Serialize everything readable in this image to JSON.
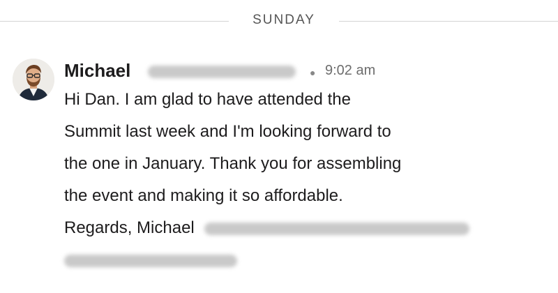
{
  "divider": {
    "day": "SUNDAY"
  },
  "message": {
    "sender_first_name": "Michael",
    "timestamp": "9:02 am",
    "lines": [
      "Hi Dan.  I am glad to have attended the",
      "Summit last week and I'm looking forward to",
      "the one in January.  Thank you for assembling",
      "the event and making it so affordable.",
      "Regards, Michael"
    ]
  },
  "colors": {
    "text": "#1d1c1d",
    "muted": "#6d6d6d",
    "divider": "#d4d4d4",
    "redaction": "#c9c9c9"
  },
  "icons": {
    "avatar": "user-avatar-photo"
  }
}
